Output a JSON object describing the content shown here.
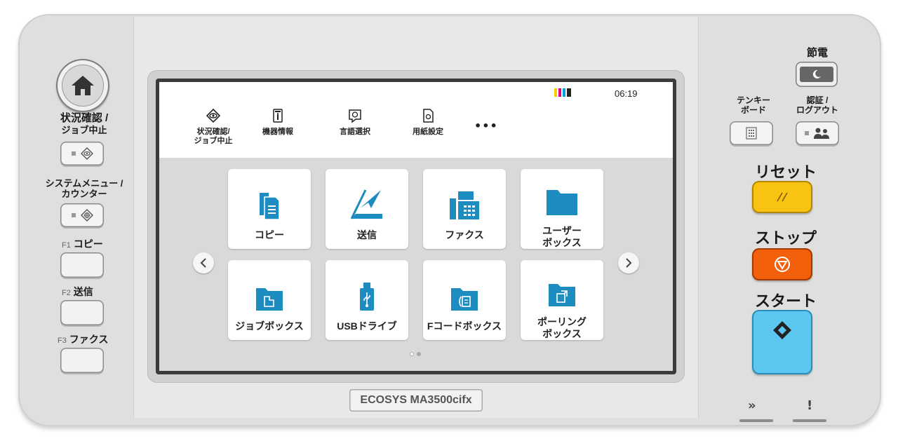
{
  "left_panel": {
    "status_label_1": "状況確認 /",
    "status_label_2": "ジョブ中止",
    "sysmenu_label_1": "システムメニュー /",
    "sysmenu_label_2": "カウンター",
    "f1_prefix": "F1",
    "f1_label": "コピー",
    "f2_prefix": "F2",
    "f2_label": "送信",
    "f3_prefix": "F3",
    "f3_label": "ファクス"
  },
  "screen": {
    "time": "06:19",
    "quick_actions": [
      {
        "label": "状況確認/\nジョブ中止",
        "icon": "eye-icon"
      },
      {
        "label": "機器情報",
        "icon": "device-info-icon"
      },
      {
        "label": "言語選択",
        "icon": "language-icon"
      },
      {
        "label": "用紙設定",
        "icon": "paper-settings-icon"
      }
    ],
    "more": "•••",
    "tiles": [
      {
        "label": "コピー",
        "icon": "copy-icon"
      },
      {
        "label": "送信",
        "icon": "send-icon"
      },
      {
        "label": "ファクス",
        "icon": "fax-icon"
      },
      {
        "label": "ユーザー\nボックス",
        "icon": "user-box-icon"
      },
      {
        "label": "ジョブボックス",
        "icon": "job-box-icon"
      },
      {
        "label": "USBドライブ",
        "icon": "usb-icon"
      },
      {
        "label": "Fコードボックス",
        "icon": "fcode-box-icon"
      },
      {
        "label": "ポーリング\nボックス",
        "icon": "polling-box-icon"
      }
    ],
    "toner_colors": [
      "#f5d000",
      "#e6007e",
      "#00a0e9",
      "#222222"
    ]
  },
  "model_name": "ECOSYS MA3500cifx",
  "right_panel": {
    "energy_saver": "節電",
    "tenkey_1": "テンキー",
    "tenkey_2": "ボード",
    "auth_1": "認証 /",
    "auth_2": "ログアウト",
    "reset": "リセット",
    "stop": "ストップ",
    "start": "スタート",
    "indicator_processing": "»",
    "indicator_attention": "!"
  },
  "colors": {
    "accent_blue": "#1d8cc0",
    "reset_yellow": "#f8c313",
    "stop_orange": "#f2600c",
    "start_cyan": "#5cc8f2"
  }
}
